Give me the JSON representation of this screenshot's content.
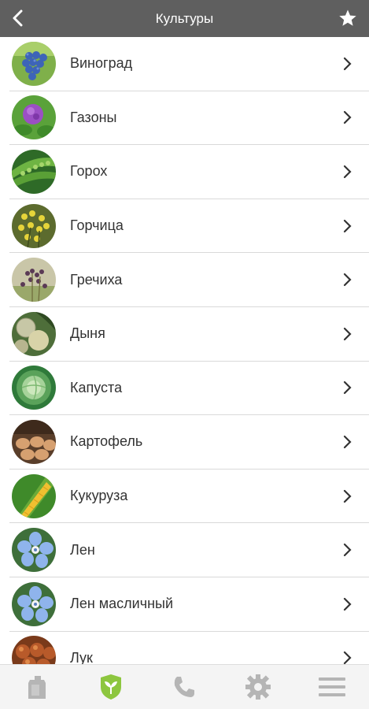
{
  "header": {
    "title": "Культуры",
    "back_icon": "chevron-left-icon",
    "favorite_icon": "star-icon"
  },
  "crops": [
    {
      "id": "grapes",
      "label": "Виноград",
      "icon": "grapes-photo"
    },
    {
      "id": "lawns",
      "label": "Газоны",
      "icon": "clover-photo"
    },
    {
      "id": "peas",
      "label": "Горох",
      "icon": "pea-pod-photo"
    },
    {
      "id": "mustard",
      "label": "Горчица",
      "icon": "mustard-flower-photo"
    },
    {
      "id": "buckwheat",
      "label": "Гречиха",
      "icon": "buckwheat-photo"
    },
    {
      "id": "melon",
      "label": "Дыня",
      "icon": "melon-photo"
    },
    {
      "id": "cabbage",
      "label": "Капуста",
      "icon": "cabbage-photo"
    },
    {
      "id": "potato",
      "label": "Картофель",
      "icon": "potato-photo"
    },
    {
      "id": "corn",
      "label": "Кукуруза",
      "icon": "corn-photo"
    },
    {
      "id": "flax",
      "label": "Лен",
      "icon": "flax-flower-photo"
    },
    {
      "id": "oil-flax",
      "label": "Лен масличный",
      "icon": "flax-flower-photo"
    },
    {
      "id": "onion",
      "label": "Лук",
      "icon": "onion-photo"
    }
  ],
  "tabbar": [
    {
      "id": "products",
      "icon": "canister-icon",
      "active": false
    },
    {
      "id": "crops",
      "icon": "shield-leaf-icon",
      "active": true
    },
    {
      "id": "contacts",
      "icon": "phone-icon",
      "active": false
    },
    {
      "id": "settings",
      "icon": "gear-icon",
      "active": false
    },
    {
      "id": "menu",
      "icon": "hamburger-menu-icon",
      "active": false
    }
  ],
  "colors": {
    "header_bg": "#5f5f5f",
    "active_tab": "#8dc63f",
    "inactive_tab": "#b5b5b5",
    "text": "#333333",
    "divider": "#d9d9d9"
  }
}
